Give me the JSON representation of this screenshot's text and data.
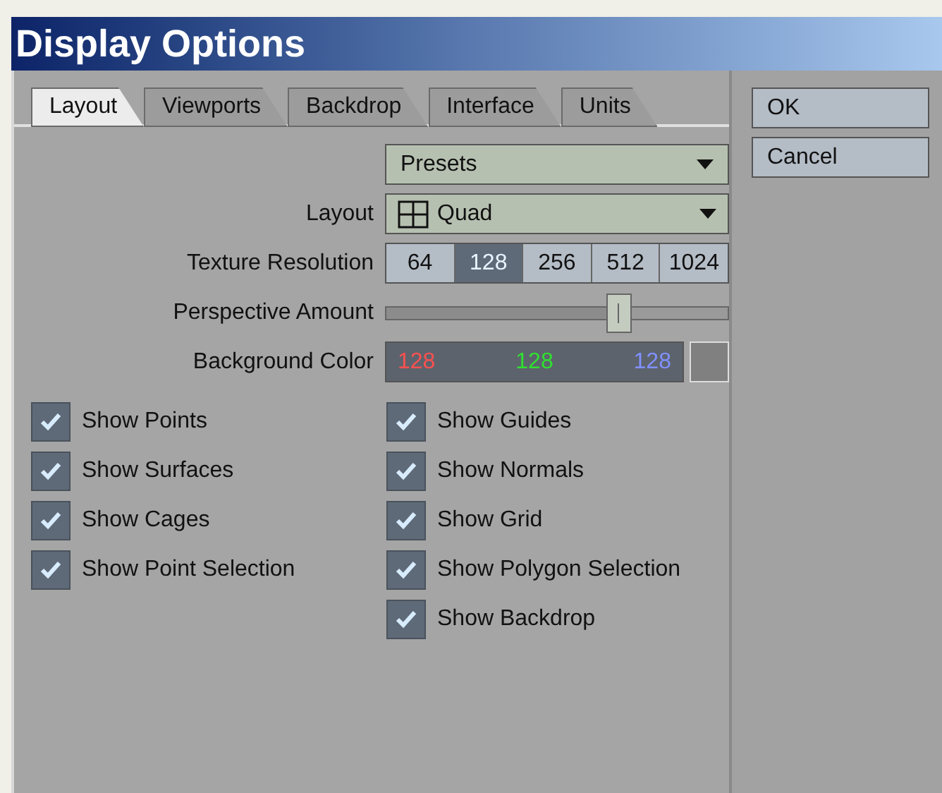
{
  "window": {
    "title": "Display Options"
  },
  "tabs": [
    {
      "label": "Layout",
      "selected": true
    },
    {
      "label": "Viewports",
      "selected": false
    },
    {
      "label": "Backdrop",
      "selected": false
    },
    {
      "label": "Interface",
      "selected": false
    },
    {
      "label": "Units",
      "selected": false
    }
  ],
  "presets": {
    "value": "Presets"
  },
  "layout": {
    "label": "Layout",
    "value": "Quad"
  },
  "texture_resolution": {
    "label": "Texture Resolution",
    "options": [
      {
        "label": "64",
        "selected": false
      },
      {
        "label": "128",
        "selected": true
      },
      {
        "label": "256",
        "selected": false
      },
      {
        "label": "512",
        "selected": false
      },
      {
        "label": "1024",
        "selected": false
      }
    ]
  },
  "perspective_amount": {
    "label": "Perspective Amount",
    "level": 0.68
  },
  "background_color": {
    "label": "Background Color",
    "red": "128",
    "green": "128",
    "blue": "128",
    "color": "#808080"
  },
  "left_checks": [
    {
      "label": "Show Points",
      "checked": true
    },
    {
      "label": "Show Surfaces",
      "checked": true
    },
    {
      "label": "Show Cages",
      "checked": true
    },
    {
      "label": "Show Point Selection",
      "checked": true
    }
  ],
  "right_checks": [
    {
      "label": "Show Guides",
      "checked": true
    },
    {
      "label": "Show Normals",
      "checked": true
    },
    {
      "label": "Show Grid",
      "checked": true
    },
    {
      "label": "Show Polygon Selection",
      "checked": true
    },
    {
      "label": "Show Backdrop",
      "checked": true
    }
  ],
  "buttons": [
    {
      "label": "OK"
    },
    {
      "label": "Cancel"
    }
  ]
}
